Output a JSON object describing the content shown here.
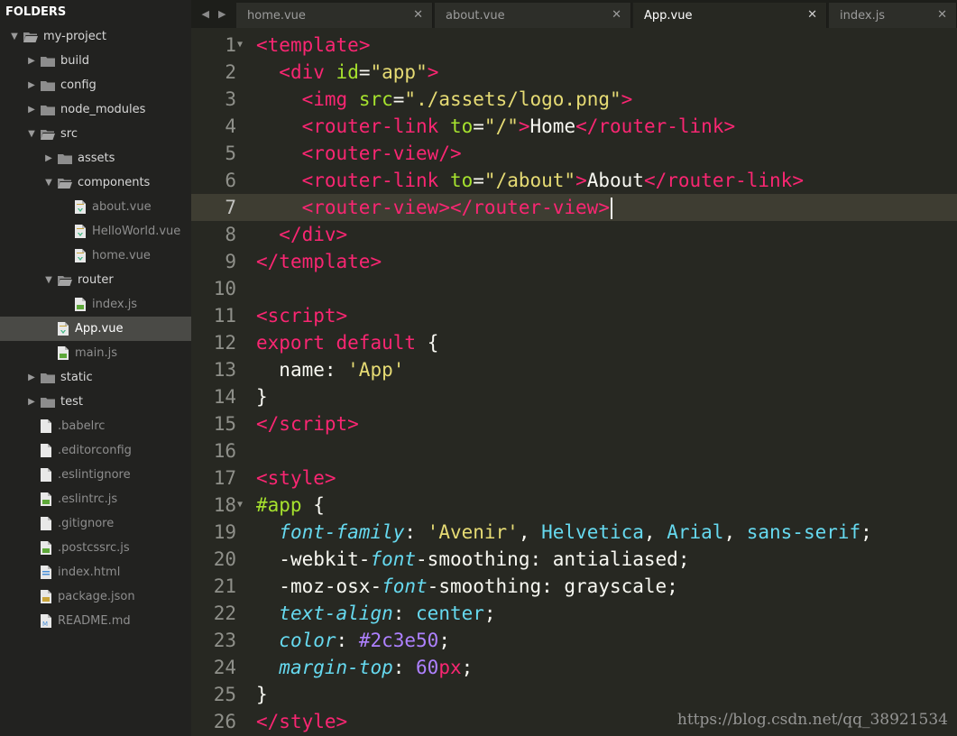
{
  "sidebar": {
    "header": "FOLDERS",
    "tree": [
      {
        "label": "my-project",
        "type": "folder",
        "open": true,
        "depth": 0
      },
      {
        "label": "build",
        "type": "folder",
        "open": false,
        "depth": 1
      },
      {
        "label": "config",
        "type": "folder",
        "open": false,
        "depth": 1
      },
      {
        "label": "node_modules",
        "type": "folder",
        "open": false,
        "depth": 1
      },
      {
        "label": "src",
        "type": "folder",
        "open": true,
        "depth": 1
      },
      {
        "label": "assets",
        "type": "folder",
        "open": false,
        "depth": 2
      },
      {
        "label": "components",
        "type": "folder",
        "open": true,
        "depth": 2
      },
      {
        "label": "about.vue",
        "type": "file",
        "icon": "vue-file-icon",
        "depth": 3
      },
      {
        "label": "HelloWorld.vue",
        "type": "file",
        "icon": "vue-file-icon",
        "depth": 3
      },
      {
        "label": "home.vue",
        "type": "file",
        "icon": "vue-file-icon",
        "depth": 3
      },
      {
        "label": "router",
        "type": "folder",
        "open": true,
        "depth": 2
      },
      {
        "label": "index.js",
        "type": "file",
        "icon": "js-file-icon",
        "depth": 3
      },
      {
        "label": "App.vue",
        "type": "file",
        "icon": "vue-file-icon",
        "depth": 2,
        "selected": true
      },
      {
        "label": "main.js",
        "type": "file",
        "icon": "js-file-icon",
        "depth": 2
      },
      {
        "label": "static",
        "type": "folder",
        "open": false,
        "depth": 1
      },
      {
        "label": "test",
        "type": "folder",
        "open": false,
        "depth": 1
      },
      {
        "label": ".babelrc",
        "type": "file",
        "icon": "plain-file-icon",
        "depth": 1
      },
      {
        "label": ".editorconfig",
        "type": "file",
        "icon": "plain-file-icon",
        "depth": 1
      },
      {
        "label": ".eslintignore",
        "type": "file",
        "icon": "plain-file-icon",
        "depth": 1
      },
      {
        "label": ".eslintrc.js",
        "type": "file",
        "icon": "js-file-icon",
        "depth": 1
      },
      {
        "label": ".gitignore",
        "type": "file",
        "icon": "plain-file-icon",
        "depth": 1
      },
      {
        "label": ".postcssrc.js",
        "type": "file",
        "icon": "js-file-icon",
        "depth": 1
      },
      {
        "label": "index.html",
        "type": "file",
        "icon": "html-file-icon",
        "depth": 1
      },
      {
        "label": "package.json",
        "type": "file",
        "icon": "json-file-icon",
        "depth": 1
      },
      {
        "label": "README.md",
        "type": "file",
        "icon": "md-file-icon",
        "depth": 1
      }
    ]
  },
  "tabs": [
    {
      "label": "home.vue",
      "active": false
    },
    {
      "label": "about.vue",
      "active": false
    },
    {
      "label": "App.vue",
      "active": true
    },
    {
      "label": "index.js",
      "active": false
    }
  ],
  "tab_close_glyph": "✕",
  "editor": {
    "current_line": 7,
    "fold_lines": [
      1,
      18
    ],
    "lines": [
      [
        [
          "tag",
          "<"
        ],
        [
          "tag_name",
          "template"
        ],
        [
          "tag",
          ">"
        ]
      ],
      [
        [
          "ws",
          "  "
        ],
        [
          "tag",
          "<"
        ],
        [
          "tag_name",
          "div"
        ],
        [
          "ws",
          " "
        ],
        [
          "attr",
          "id"
        ],
        [
          "default",
          "="
        ],
        [
          "string",
          "\"app\""
        ],
        [
          "tag",
          ">"
        ]
      ],
      [
        [
          "ws",
          "    "
        ],
        [
          "tag",
          "<"
        ],
        [
          "tag_name",
          "img"
        ],
        [
          "ws",
          " "
        ],
        [
          "attr",
          "src"
        ],
        [
          "default",
          "="
        ],
        [
          "string",
          "\"./assets/logo.png\""
        ],
        [
          "tag",
          ">"
        ]
      ],
      [
        [
          "ws",
          "    "
        ],
        [
          "tag",
          "<"
        ],
        [
          "tag_name",
          "router-link"
        ],
        [
          "ws",
          " "
        ],
        [
          "attr",
          "to"
        ],
        [
          "default",
          "="
        ],
        [
          "string",
          "\"/\""
        ],
        [
          "tag",
          ">"
        ],
        [
          "default",
          "Home"
        ],
        [
          "tag",
          "</"
        ],
        [
          "tag_name",
          "router-link"
        ],
        [
          "tag",
          ">"
        ]
      ],
      [
        [
          "ws",
          "    "
        ],
        [
          "tag",
          "<"
        ],
        [
          "tag_name",
          "router-view"
        ],
        [
          "tag",
          "/>"
        ]
      ],
      [
        [
          "ws",
          "    "
        ],
        [
          "tag",
          "<"
        ],
        [
          "tag_name",
          "router-link"
        ],
        [
          "ws",
          " "
        ],
        [
          "attr",
          "to"
        ],
        [
          "default",
          "="
        ],
        [
          "string",
          "\"/about\""
        ],
        [
          "tag",
          ">"
        ],
        [
          "default",
          "About"
        ],
        [
          "tag",
          "</"
        ],
        [
          "tag_name",
          "router-link"
        ],
        [
          "tag",
          ">"
        ]
      ],
      [
        [
          "ws",
          "    "
        ],
        [
          "tag",
          "<"
        ],
        [
          "tag_name",
          "router-view"
        ],
        [
          "tag",
          "></"
        ],
        [
          "tag_name",
          "router-view"
        ],
        [
          "tag",
          ">"
        ]
      ],
      [
        [
          "ws",
          "  "
        ],
        [
          "tag",
          "</"
        ],
        [
          "tag_name",
          "div"
        ],
        [
          "tag",
          ">"
        ]
      ],
      [
        [
          "tag",
          "</"
        ],
        [
          "tag_name",
          "template"
        ],
        [
          "tag",
          ">"
        ]
      ],
      [],
      [
        [
          "tag",
          "<"
        ],
        [
          "tag_name",
          "script"
        ],
        [
          "tag",
          ">"
        ]
      ],
      [
        [
          "keyword",
          "export"
        ],
        [
          "ws",
          " "
        ],
        [
          "keyword",
          "default"
        ],
        [
          "ws",
          " "
        ],
        [
          "default",
          "{"
        ]
      ],
      [
        [
          "ws",
          "  "
        ],
        [
          "default",
          "name: "
        ],
        [
          "string",
          "'App'"
        ]
      ],
      [
        [
          "default",
          "}"
        ]
      ],
      [
        [
          "tag",
          "</"
        ],
        [
          "tag_name",
          "script"
        ],
        [
          "tag",
          ">"
        ]
      ],
      [],
      [
        [
          "tag",
          "<"
        ],
        [
          "tag_name",
          "style"
        ],
        [
          "tag",
          ">"
        ]
      ],
      [
        [
          "selector",
          "#app"
        ],
        [
          "default",
          " {"
        ]
      ],
      [
        [
          "ws",
          "  "
        ],
        [
          "property",
          "font-family"
        ],
        [
          "default",
          ": "
        ],
        [
          "string",
          "'Avenir'"
        ],
        [
          "default",
          ", "
        ],
        [
          "value",
          "Helvetica"
        ],
        [
          "default",
          ", "
        ],
        [
          "value",
          "Arial"
        ],
        [
          "default",
          ", "
        ],
        [
          "value",
          "sans-serif"
        ],
        [
          "default",
          ";"
        ]
      ],
      [
        [
          "ws",
          "  "
        ],
        [
          "default",
          "-webkit-"
        ],
        [
          "property",
          "font"
        ],
        [
          "default",
          "-smoothing: antialiased;"
        ]
      ],
      [
        [
          "ws",
          "  "
        ],
        [
          "default",
          "-moz-osx-"
        ],
        [
          "property",
          "font"
        ],
        [
          "default",
          "-smoothing: grayscale;"
        ]
      ],
      [
        [
          "ws",
          "  "
        ],
        [
          "property",
          "text-align"
        ],
        [
          "default",
          ": "
        ],
        [
          "value",
          "center"
        ],
        [
          "default",
          ";"
        ]
      ],
      [
        [
          "ws",
          "  "
        ],
        [
          "property",
          "color"
        ],
        [
          "default",
          ": "
        ],
        [
          "number",
          "#2c3e50"
        ],
        [
          "default",
          ";"
        ]
      ],
      [
        [
          "ws",
          "  "
        ],
        [
          "property",
          "margin-top"
        ],
        [
          "default",
          ": "
        ],
        [
          "number",
          "60"
        ],
        [
          "keyword",
          "px"
        ],
        [
          "default",
          ";"
        ]
      ],
      [
        [
          "default",
          "}"
        ]
      ],
      [
        [
          "tag",
          "</"
        ],
        [
          "tag_name",
          "style"
        ],
        [
          "tag",
          ">"
        ]
      ]
    ]
  },
  "watermark": "https://blog.csdn.net/qq_38921534",
  "colors": {
    "background": "#272822",
    "sidebar": "#222220",
    "current_line": "#3e3d32",
    "tag": "#f92672",
    "attr": "#a6e22e",
    "string": "#e6db74",
    "keyword": "#f92672",
    "property": "#66d9ef",
    "number": "#ae81ff",
    "text": "#f8f8f2"
  }
}
